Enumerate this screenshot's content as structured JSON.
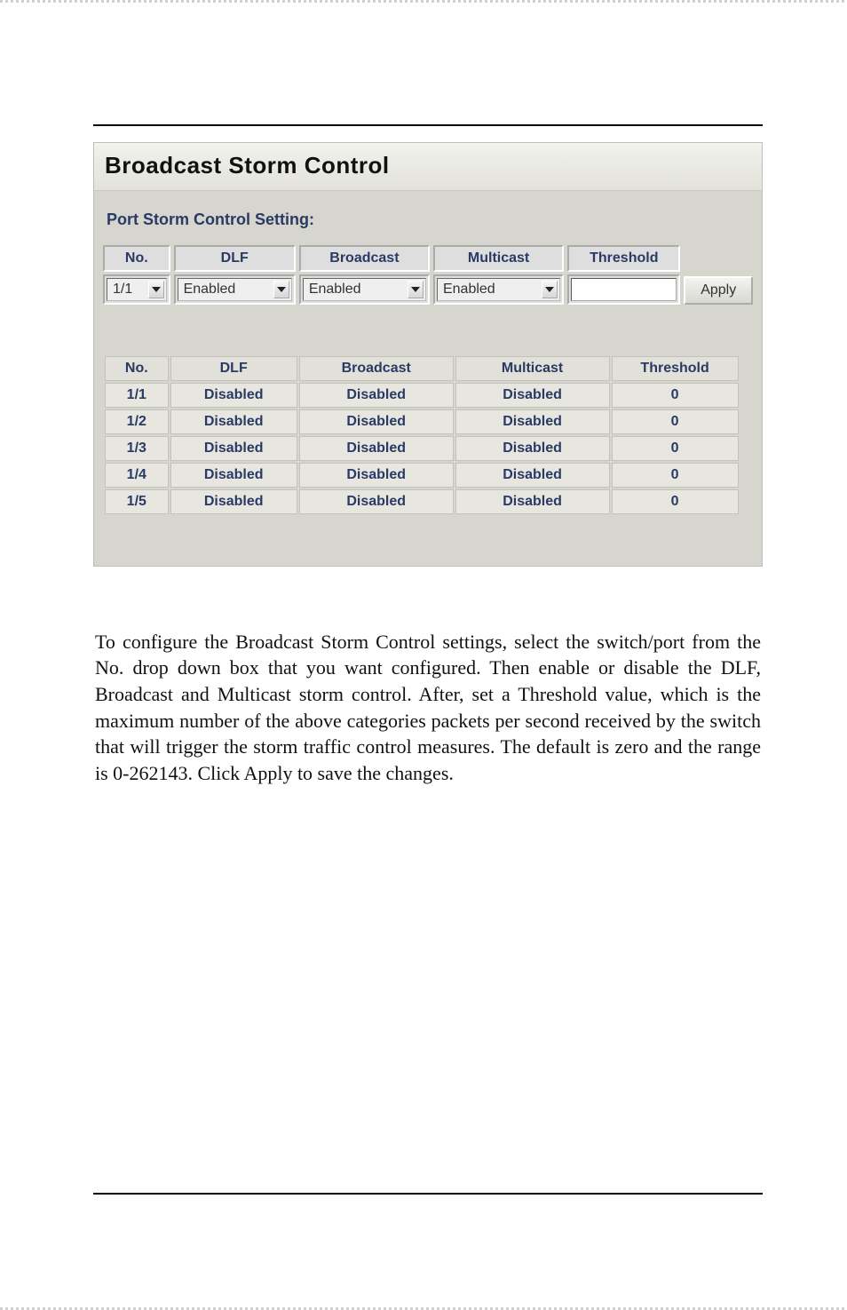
{
  "panel": {
    "title": "Broadcast Storm Control",
    "subtitle": "Port Storm Control Setting:",
    "form": {
      "headers": {
        "no": "No.",
        "dlf": "DLF",
        "broadcast": "Broadcast",
        "multicast": "Multicast",
        "threshold": "Threshold"
      },
      "values": {
        "no": "1/1",
        "dlf": "Enabled",
        "broadcast": "Enabled",
        "multicast": "Enabled",
        "threshold": ""
      },
      "apply_label": "Apply"
    },
    "status": {
      "headers": {
        "no": "No.",
        "dlf": "DLF",
        "broadcast": "Broadcast",
        "multicast": "Multicast",
        "threshold": "Threshold"
      },
      "rows": [
        {
          "no": "1/1",
          "dlf": "Disabled",
          "broadcast": "Disabled",
          "multicast": "Disabled",
          "threshold": "0"
        },
        {
          "no": "1/2",
          "dlf": "Disabled",
          "broadcast": "Disabled",
          "multicast": "Disabled",
          "threshold": "0"
        },
        {
          "no": "1/3",
          "dlf": "Disabled",
          "broadcast": "Disabled",
          "multicast": "Disabled",
          "threshold": "0"
        },
        {
          "no": "1/4",
          "dlf": "Disabled",
          "broadcast": "Disabled",
          "multicast": "Disabled",
          "threshold": "0"
        },
        {
          "no": "1/5",
          "dlf": "Disabled",
          "broadcast": "Disabled",
          "multicast": "Disabled",
          "threshold": "0"
        }
      ]
    }
  },
  "paragraph": "To configure the Broadcast Storm Control settings, select the switch/port from the No. drop down box that you want configured. Then enable or disable the DLF, Broadcast and Multicast storm control.  After, set a Threshold value, which is the maximum number of the above categories packets per second received by the switch that will trigger the storm traffic control measures. The default is zero and the range is 0-262143.  Click Apply to save the changes."
}
